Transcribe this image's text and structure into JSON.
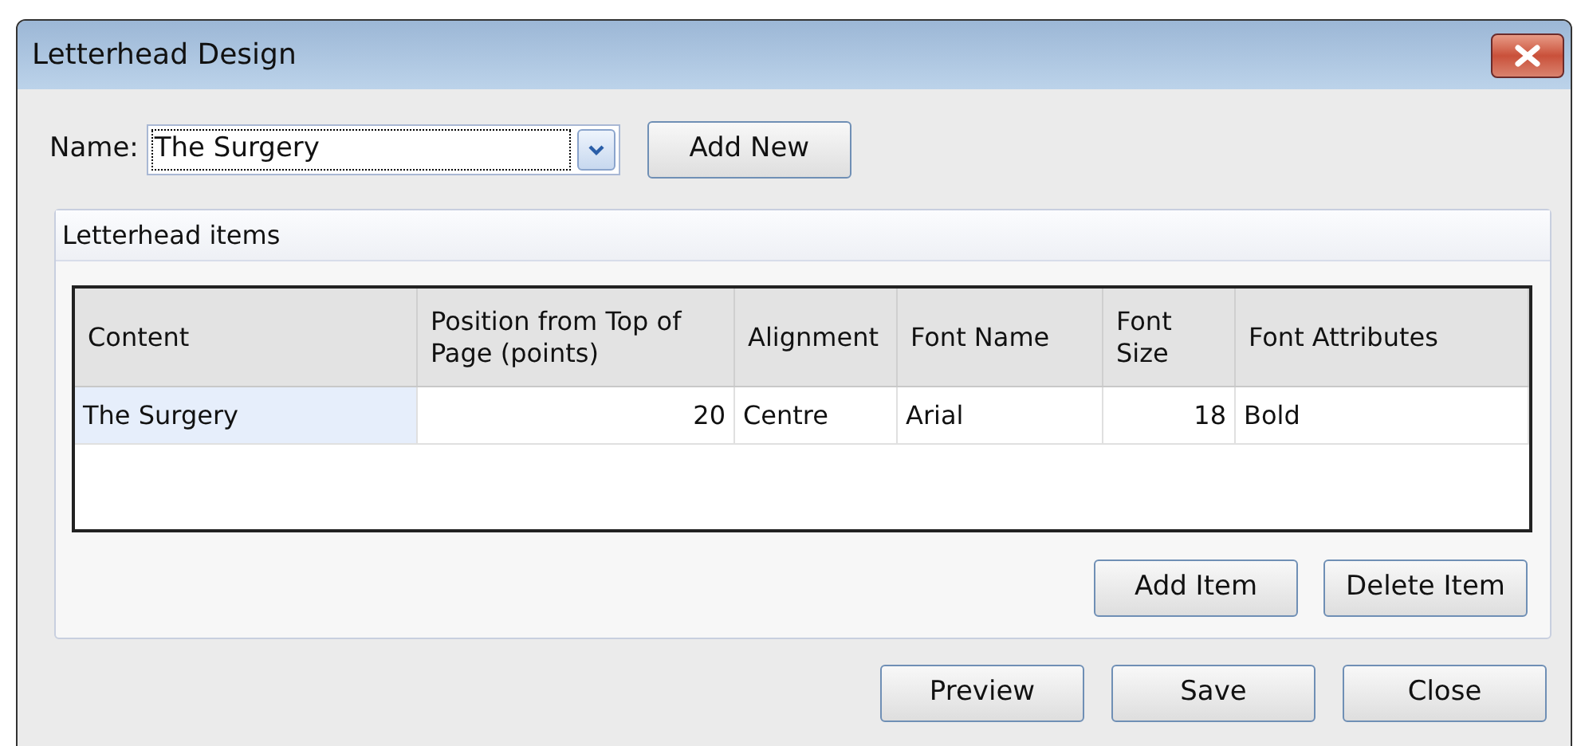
{
  "window": {
    "title": "Letterhead Design"
  },
  "name_field": {
    "label": "Name:",
    "value": "The Surgery"
  },
  "add_new_button": "Add New",
  "group": {
    "title": "Letterhead items",
    "table": {
      "columns": [
        {
          "label": "Content",
          "kind": "text"
        },
        {
          "label": "Position from Top of Page (points)",
          "kind": "number"
        },
        {
          "label": "Alignment",
          "kind": "text"
        },
        {
          "label": "Font Name",
          "kind": "text"
        },
        {
          "label": "Font Size",
          "kind": "number"
        },
        {
          "label": "Font Attributes",
          "kind": "text"
        }
      ],
      "rows": [
        {
          "cells": [
            {
              "text": "The Surgery",
              "selected": true
            },
            {
              "text": "20",
              "selected": false
            },
            {
              "text": "Centre",
              "selected": false
            },
            {
              "text": "Arial",
              "selected": false
            },
            {
              "text": "18",
              "selected": false
            },
            {
              "text": "Bold",
              "selected": false
            }
          ]
        }
      ]
    },
    "buttons": [
      "Add Item",
      "Delete Item"
    ]
  },
  "footer_buttons": [
    "Preview",
    "Save",
    "Close"
  ]
}
